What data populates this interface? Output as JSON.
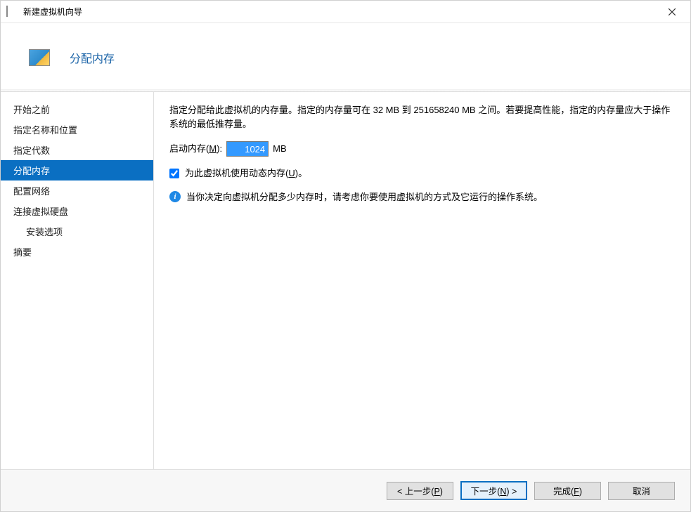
{
  "window": {
    "title": "新建虚拟机向导"
  },
  "header": {
    "title": "分配内存"
  },
  "sidebar": {
    "items": [
      {
        "label": "开始之前",
        "selected": false,
        "indent": false
      },
      {
        "label": "指定名称和位置",
        "selected": false,
        "indent": false
      },
      {
        "label": "指定代数",
        "selected": false,
        "indent": false
      },
      {
        "label": "分配内存",
        "selected": true,
        "indent": false
      },
      {
        "label": "配置网络",
        "selected": false,
        "indent": false
      },
      {
        "label": "连接虚拟硬盘",
        "selected": false,
        "indent": false
      },
      {
        "label": "安装选项",
        "selected": false,
        "indent": true
      },
      {
        "label": "摘要",
        "selected": false,
        "indent": false
      }
    ]
  },
  "content": {
    "description": "指定分配给此虚拟机的内存量。指定的内存量可在 32 MB 到 251658240 MB 之间。若要提高性能，指定的内存量应大于操作系统的最低推荐量。",
    "memory_label_pre": "启动内存(",
    "memory_accel": "M",
    "memory_label_post": "):",
    "memory_value": "1024",
    "memory_unit": "MB",
    "dynmem_label_pre": "为此虚拟机使用动态内存(",
    "dynmem_accel": "U",
    "dynmem_label_post": ")。",
    "dynmem_checked": true,
    "info_text": "当你决定向虚拟机分配多少内存时，请考虑你要使用虚拟机的方式及它运行的操作系统。"
  },
  "footer": {
    "prev_pre": "< 上一步(",
    "prev_accel": "P",
    "prev_post": ")",
    "next_pre": "下一步(",
    "next_accel": "N",
    "next_post": ") >",
    "finish_pre": "完成(",
    "finish_accel": "F",
    "finish_post": ")",
    "cancel": "取消"
  }
}
